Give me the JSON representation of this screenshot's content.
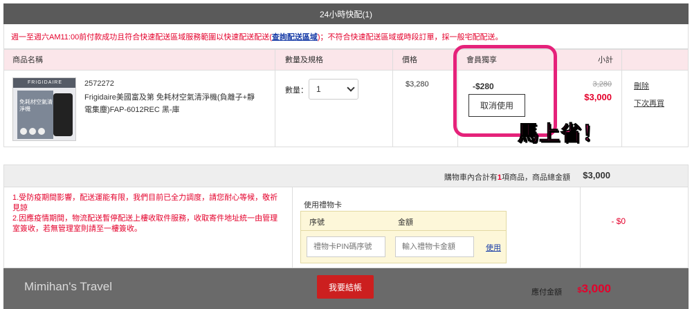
{
  "header": {
    "title": "24小時快配(1)"
  },
  "notice": {
    "text_before": "週一至週六AM11:00前付款成功且符合快速配送區域服務範圍以快速配送配送(",
    "link": "查詢配送區域",
    "text_after": ")；不符合快速配送區域或時段訂單，採一般宅配配送。"
  },
  "table": {
    "headers": {
      "product": "商品名稱",
      "qty": "數量及規格",
      "price": "價格",
      "member": "會員獨享",
      "subtotal": "小計"
    }
  },
  "item": {
    "thumb_brand": "FRIGIDAIRE",
    "thumb_text": "免耗材空氣清淨機",
    "code": "2572272",
    "name": "Frigidaire美國富及第 免耗材空氣清淨機(負離子+靜電集塵)FAP-6012REC 黑-庫",
    "qty_label": "數量：",
    "qty_value": "1",
    "price": "$3,280",
    "member_discount": "-$280",
    "cancel_label": "取消使用",
    "original_subtotal": "3,280",
    "final_subtotal": "$3,000",
    "delete_label": "刪除",
    "later_label": "下次再買"
  },
  "annotation": {
    "text": "馬上省！",
    "color": "#e5227a"
  },
  "summary": {
    "text_before": "購物車內合計有",
    "count": "1",
    "text_after": "項商品，商品總金額",
    "total": "$3,000"
  },
  "notes": {
    "line1": "1.受防疫期間影響，配送運能有限，我們目前已全力調度，請您耐心等候，敬祈見諒",
    "line2": "2.因應疫情期間，物流配送暫停配送上樓收取件服務，收取寄件地址統一由管理室簽收，若無管理室則請至一樓簽收。"
  },
  "gift_card": {
    "title": "使用禮物卡",
    "col_serial": "序號",
    "col_amount": "金額",
    "serial_placeholder": "禮物卡PIN碼序號",
    "amount_placeholder": "輸入禮物卡金額",
    "use_label": "使用",
    "discount": "- $0"
  },
  "footer": {
    "watermark": "Mimihan's Travel",
    "checkout_label": "我要結帳",
    "due_label": "應付金額",
    "due_currency": "$",
    "due_amount": "3,000"
  },
  "colors": {
    "accent_red": "#e4002b",
    "checkout_red": "#cc1f1f",
    "header_pink": "#fbe6ea",
    "link_blue": "#1a3ea8"
  }
}
